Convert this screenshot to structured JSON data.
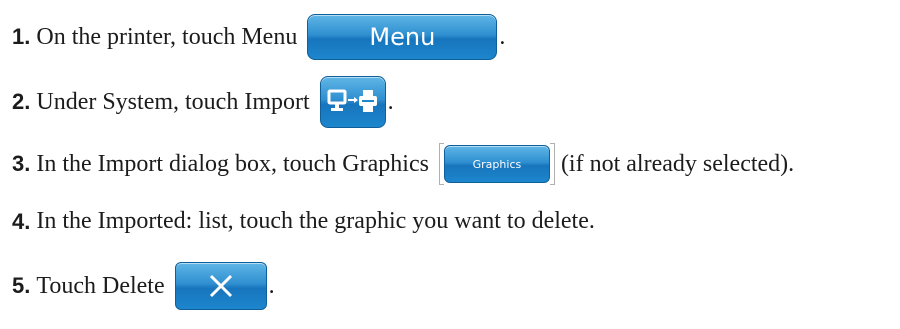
{
  "steps": [
    {
      "num": "1.",
      "text": "On the printer, touch Menu",
      "button_label": "Menu",
      "after": "."
    },
    {
      "num": "2.",
      "text": "Under System, touch Import",
      "button_icon": "computer-to-printer-icon",
      "after": "."
    },
    {
      "num": "3.",
      "text": "In the Import dialog box, touch Graphics",
      "button_label": "Graphics",
      "after": "(if not already selected)."
    },
    {
      "num": "4.",
      "text": "In the Imported: list, touch the graphic you want to delete."
    },
    {
      "num": "5.",
      "text": "Touch Delete",
      "button_icon": "close-x-icon",
      "after": "."
    }
  ],
  "colors": {
    "button_blue": "#1d86cc",
    "text": "#1c1c1c"
  }
}
